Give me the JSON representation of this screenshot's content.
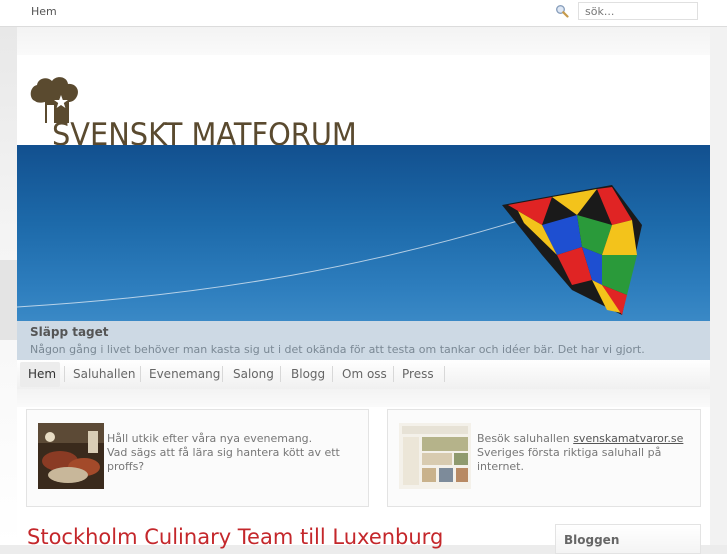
{
  "topbar": {
    "home_label": "Hem",
    "search": {
      "placeholder": "sök..."
    }
  },
  "site": {
    "title": "SVENSKT MATFORUM",
    "logo_icon": "chef-hat-icon"
  },
  "hero": {
    "caption_title": "Släpp taget",
    "caption_text": "Någon gång i livet behöver man kasta sig ut i det okända för att testa om tankar och idéer bär. Det har vi gjort."
  },
  "nav": {
    "items": [
      {
        "label": "Hem",
        "active": true
      },
      {
        "label": "Saluhallen"
      },
      {
        "label": "Evenemang"
      },
      {
        "label": "Salong"
      },
      {
        "label": "Blogg"
      },
      {
        "label": "Om oss"
      },
      {
        "label": "Press"
      }
    ]
  },
  "promos": [
    {
      "line1": "Håll utkik efter våra nya evenemang.",
      "line2": "Vad sägs att få lära sig hantera kött av ett",
      "line3": "proffs?"
    },
    {
      "prefix": "Besök saluhallen ",
      "link": "svenskamatvaror.se",
      "line2": "Sveriges första riktiga saluhall på",
      "line3": "internet."
    }
  ],
  "article": {
    "title": "Stockholm Culinary Team till Luxenburg"
  },
  "sidebar": {
    "blog_title": "Bloggen"
  },
  "colors": {
    "accent_red": "#c4272b",
    "logo_brown": "#5a4a2f",
    "sky_blue": "#1d6aaa"
  }
}
